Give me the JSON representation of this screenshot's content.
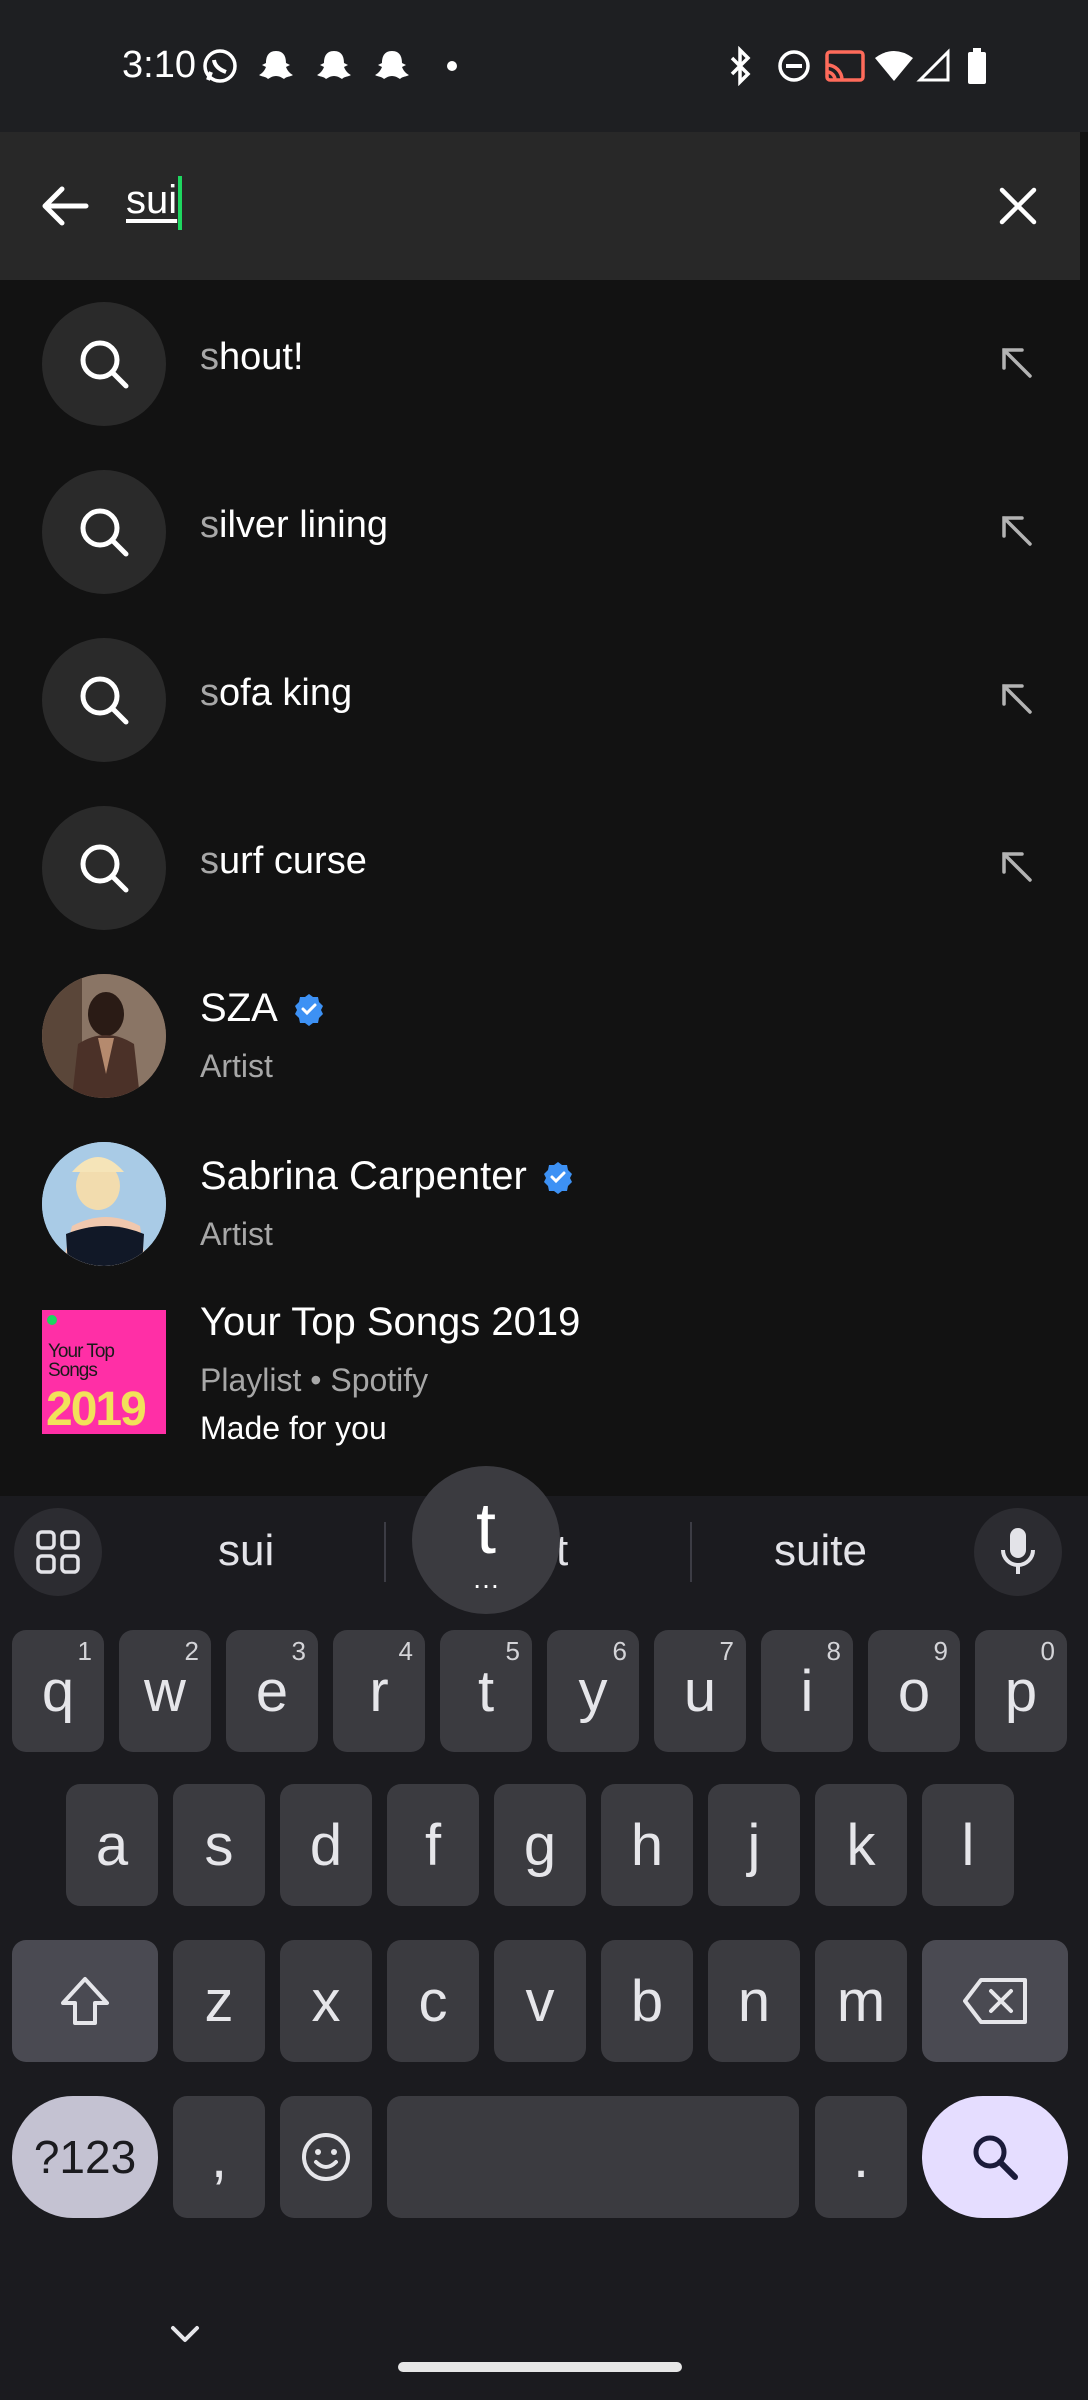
{
  "status_bar": {
    "time": "3:10",
    "left_icons": [
      "whatsapp-icon",
      "snapchat-icon",
      "snapchat-icon",
      "snapchat-icon",
      "dot-icon"
    ],
    "right_icons": [
      "bluetooth-icon",
      "do-not-disturb-icon",
      "cast-icon",
      "wifi-icon",
      "signal-icon",
      "battery-icon"
    ]
  },
  "search": {
    "query": "sui"
  },
  "suggestions": [
    {
      "first": "s",
      "rest": "hout!"
    },
    {
      "first": "s",
      "rest": "ilver lining"
    },
    {
      "first": "s",
      "rest": "ofa king"
    },
    {
      "first": "s",
      "rest": "urf curse"
    }
  ],
  "results": [
    {
      "title": "SZA",
      "subtitle": "Artist",
      "verified": true
    },
    {
      "title": "Sabrina Carpenter",
      "subtitle": "Artist",
      "verified": true
    },
    {
      "title": "Your Top Songs 2019",
      "subtitle": "Playlist • Spotify",
      "note": "Made for you",
      "cover_text": "Your Top Songs",
      "cover_year": "2019"
    }
  ],
  "keyboard": {
    "suggestions": [
      "sui",
      "t",
      "suite"
    ],
    "popup_letter": "t",
    "row1": [
      {
        "k": "q",
        "h": "1"
      },
      {
        "k": "w",
        "h": "2"
      },
      {
        "k": "e",
        "h": "3"
      },
      {
        "k": "r",
        "h": "4"
      },
      {
        "k": "t",
        "h": "5"
      },
      {
        "k": "y",
        "h": "6"
      },
      {
        "k": "u",
        "h": "7"
      },
      {
        "k": "i",
        "h": "8"
      },
      {
        "k": "o",
        "h": "9"
      },
      {
        "k": "p",
        "h": "0"
      }
    ],
    "row2": [
      "a",
      "s",
      "d",
      "f",
      "g",
      "h",
      "j",
      "k",
      "l"
    ],
    "row3": [
      "z",
      "x",
      "c",
      "v",
      "b",
      "n",
      "m"
    ],
    "symbols_label": "?123",
    "comma": ",",
    "period": ".",
    "accent_color": "#e5ddff"
  },
  "colors": {
    "spotify_green": "#1ed760",
    "verified_blue": "#3d91f4",
    "background": "#121212"
  }
}
